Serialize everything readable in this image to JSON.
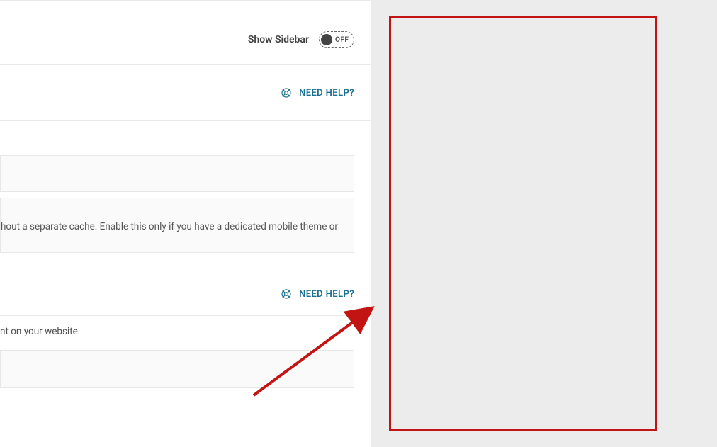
{
  "sidebar_toggle": {
    "label": "Show Sidebar",
    "state": "OFF"
  },
  "help": {
    "label": "NEED HELP?"
  },
  "cache_card": {
    "text": "hout a separate cache. Enable this only if you have a dedicated mobile theme or"
  },
  "content_meta": {
    "text": "nt on your website."
  },
  "icons": {
    "help": "help-icon"
  },
  "colors": {
    "annotate_red": "#c21513",
    "brand_teal": "#1a6f8f"
  }
}
